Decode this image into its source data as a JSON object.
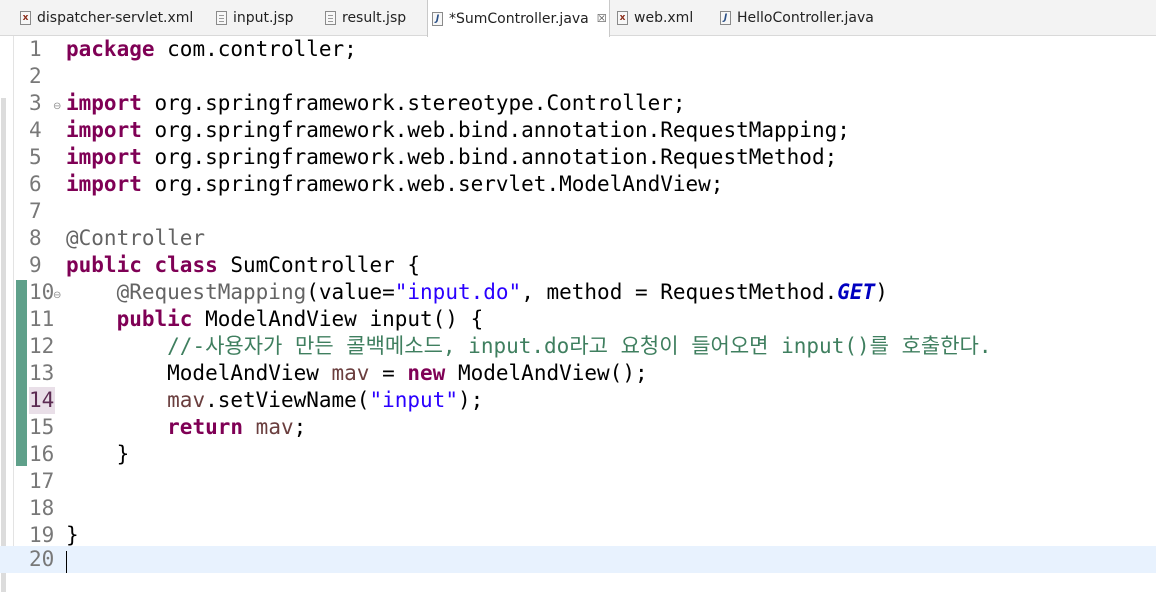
{
  "tabs": [
    {
      "label": "dispatcher-servlet.xml",
      "icon": "xml-file-icon",
      "active": false
    },
    {
      "label": "input.jsp",
      "icon": "jsp-file-icon",
      "active": false
    },
    {
      "label": "result.jsp",
      "icon": "jsp-file-icon",
      "active": false
    },
    {
      "label": "*SumController.java",
      "icon": "java-file-icon",
      "active": true,
      "close": "☒"
    },
    {
      "label": "web.xml",
      "icon": "xml-file-icon",
      "active": false
    },
    {
      "label": "HelloController.java",
      "icon": "java-file-icon",
      "active": false
    }
  ],
  "lines": [
    {
      "n": "1",
      "t": [
        [
          "kw",
          "package"
        ],
        [
          "",
          "com.controller;"
        ]
      ]
    },
    {
      "n": "2",
      "t": []
    },
    {
      "n": "3",
      "fold": true,
      "t": [
        [
          "kw",
          "import"
        ],
        [
          "",
          "org.springframework.stereotype.Controller;"
        ]
      ]
    },
    {
      "n": "4",
      "t": [
        [
          "kw",
          "import"
        ],
        [
          "",
          "org.springframework.web.bind.annotation.RequestMapping;"
        ]
      ]
    },
    {
      "n": "5",
      "t": [
        [
          "kw",
          "import"
        ],
        [
          "",
          "org.springframework.web.bind.annotation.RequestMethod;"
        ]
      ]
    },
    {
      "n": "6",
      "t": [
        [
          "kw",
          "import"
        ],
        [
          "",
          "org.springframework.web.servlet.ModelAndView;"
        ]
      ]
    },
    {
      "n": "7",
      "t": []
    },
    {
      "n": "8",
      "t": [
        [
          "ann",
          "@Controller"
        ]
      ]
    },
    {
      "n": "9",
      "t": [
        [
          "kw",
          "public"
        ],
        [
          "kw",
          "class"
        ],
        [
          "",
          "SumController {"
        ]
      ]
    },
    {
      "n": "10",
      "fold": true,
      "t": [
        [
          "",
          "    "
        ],
        [
          "ann",
          "@RequestMapping"
        ],
        [
          "",
          "(value="
        ],
        [
          "str",
          "\"input.do\""
        ],
        [
          "",
          ", method = RequestMethod."
        ],
        [
          "fld",
          "GET"
        ],
        [
          "",
          ")"
        ]
      ]
    },
    {
      "n": "11",
      "t": [
        [
          "",
          "    "
        ],
        [
          "kw",
          "public"
        ],
        [
          "",
          "ModelAndView input() {"
        ]
      ]
    },
    {
      "n": "12",
      "t": [
        [
          "",
          "        "
        ],
        [
          "cm",
          "//-사용자가 만든 콜백메소드, input.do라고 요청이 들어오면 input()를 호출한다."
        ]
      ]
    },
    {
      "n": "13",
      "t": [
        [
          "",
          "        ModelAndView "
        ],
        [
          "var",
          "mav"
        ],
        [
          "",
          " = "
        ],
        [
          "kw",
          "new"
        ],
        [
          "",
          "ModelAndView();"
        ]
      ]
    },
    {
      "n": "14",
      "hl": true,
      "t": [
        [
          "",
          "        "
        ],
        [
          "var",
          "mav"
        ],
        [
          "",
          ".setViewName("
        ],
        [
          "str",
          "\"input\""
        ],
        [
          "",
          ");"
        ]
      ]
    },
    {
      "n": "15",
      "t": [
        [
          "",
          "        "
        ],
        [
          "kw",
          "return"
        ],
        [
          "var",
          "mav"
        ],
        [
          "",
          ";"
        ]
      ]
    },
    {
      "n": "16",
      "t": [
        [
          "",
          "    }"
        ]
      ]
    },
    {
      "n": "17",
      "t": []
    },
    {
      "n": "18",
      "t": []
    },
    {
      "n": "19",
      "t": [
        [
          "",
          "}"
        ]
      ]
    },
    {
      "n": "20",
      "current": true,
      "t": []
    }
  ]
}
